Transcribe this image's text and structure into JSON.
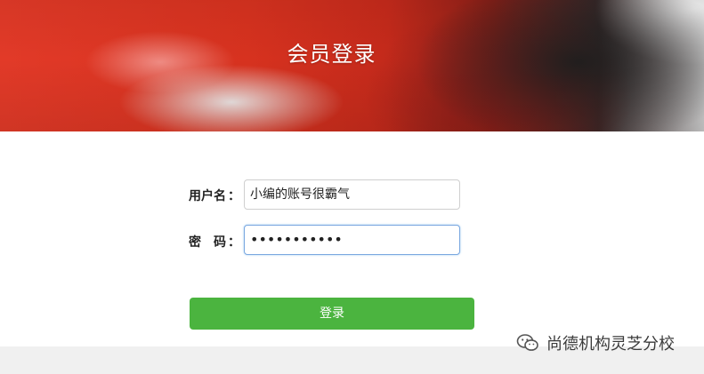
{
  "header": {
    "title": "会员登录"
  },
  "form": {
    "username_label": "用户名",
    "username_colon": "：",
    "username_value": "小编的账号很霸气",
    "password_label": "密　码",
    "password_colon": "：",
    "password_masked": "•••••••••••"
  },
  "actions": {
    "login_label": "登录"
  },
  "watermark": {
    "icon": "wechat-icon",
    "text": "尚德机构灵芝分校"
  },
  "colors": {
    "button": "#4bb43f",
    "focus_border": "#7aa7e0"
  }
}
